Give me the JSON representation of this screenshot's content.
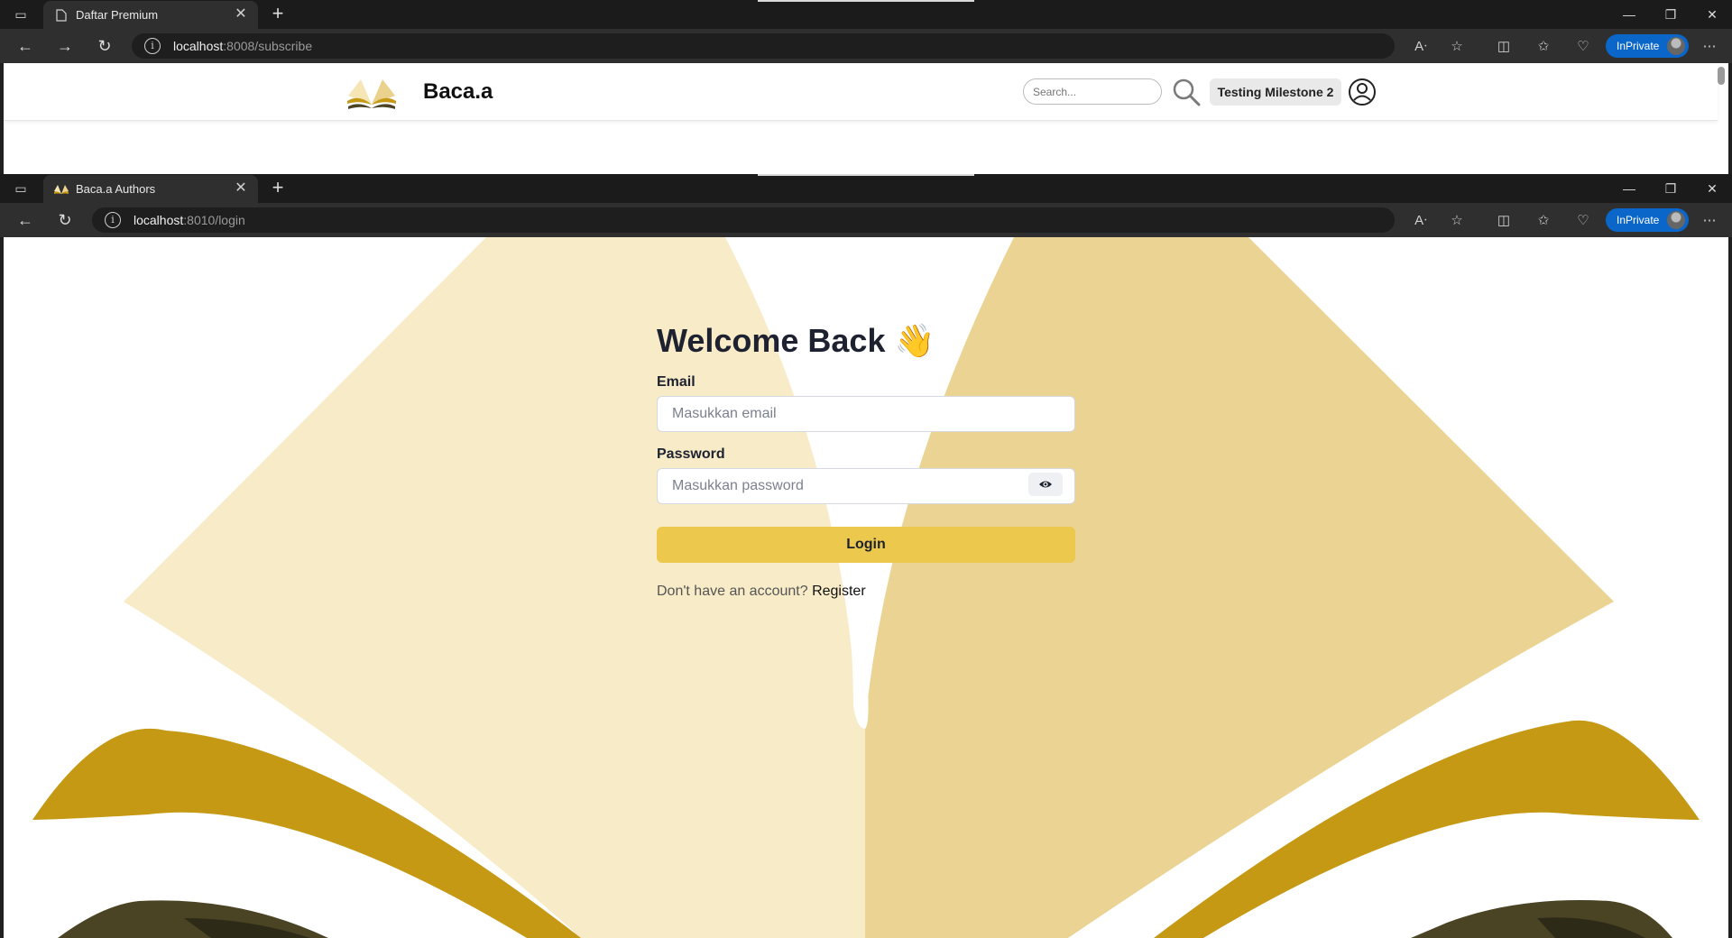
{
  "window1": {
    "tab_title": "Daftar Premium",
    "url_host": "localhost",
    "url_rest": ":8008/subscribe",
    "inprivate_label": "InPrivate",
    "page": {
      "brand": "Baca.a",
      "search_placeholder": "Search...",
      "user_name": "Testing Milestone 2"
    }
  },
  "window2": {
    "tab_title": "Baca.a Authors",
    "url_host": "localhost",
    "url_rest": ":8010/login",
    "inprivate_label": "InPrivate",
    "login": {
      "heading": "Welcome Back",
      "heading_emoji": "👋",
      "email_label": "Email",
      "email_placeholder": "Masukkan email",
      "email_value": "",
      "password_label": "Password",
      "password_placeholder": "Masukkan password",
      "password_value": "",
      "login_button": "Login",
      "register_prompt": "Don't have an account?",
      "register_link": "Register"
    }
  },
  "colors": {
    "accent_yellow": "#ecc84c",
    "art_light": "#f8ebc8",
    "art_mid": "#ebd493",
    "art_gold": "#c59914",
    "art_dark": "#4a4425",
    "inprivate_blue": "#0a66c9"
  },
  "icons": {
    "info": "info-icon",
    "eye": "eye-icon",
    "search": "search-icon",
    "account": "account-circle-icon"
  }
}
